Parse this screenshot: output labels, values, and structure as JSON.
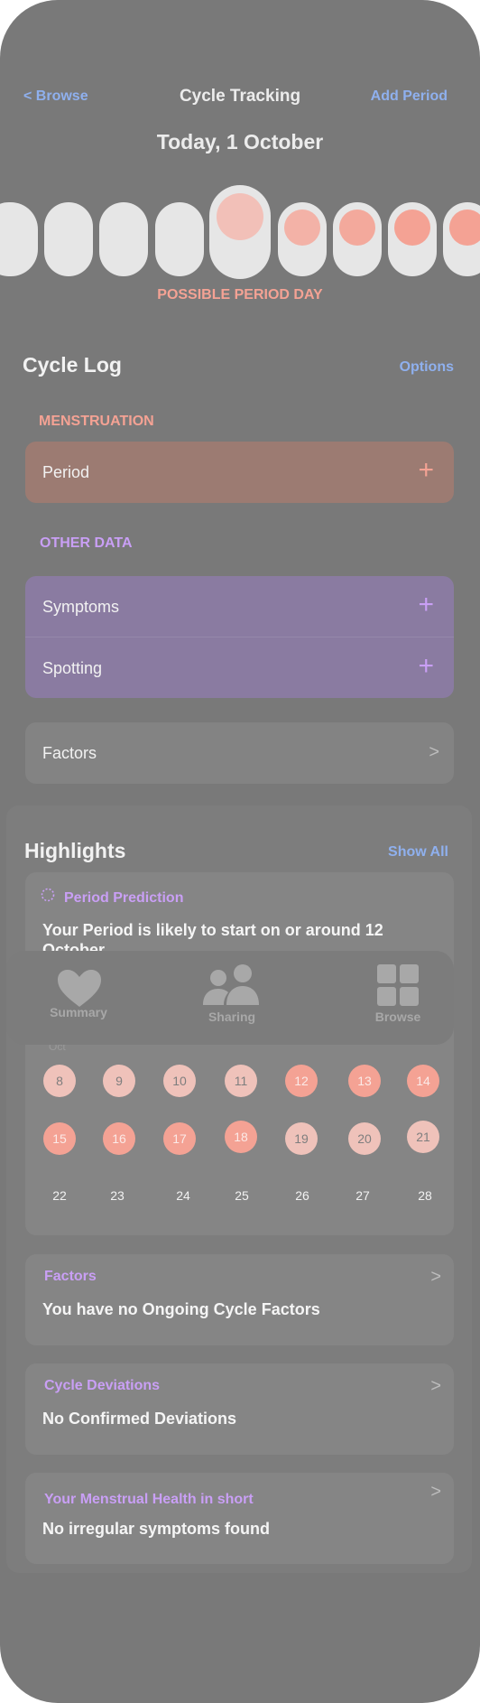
{
  "nav": {
    "back_label": "< Browse",
    "title": "Cycle Tracking",
    "add_label": "Add Period"
  },
  "date_title": "Today, 1 October",
  "day_status": "POSSIBLE PERIOD DAY",
  "cycle_log": {
    "title": "Cycle Log",
    "options_label": "Options",
    "menstruation": {
      "category": "MENSTRUATION",
      "period_label": "Period"
    },
    "other_data": {
      "category": "OTHER DATA",
      "symptoms_label": "Symptoms",
      "spotting_label": "Spotting"
    },
    "factors_label": "Factors"
  },
  "highlights": {
    "title": "Highlights",
    "show_all_label": "Show All",
    "prediction": {
      "title": "Period Prediction",
      "text": "Your Period is likely to start on or around 12 October",
      "month_label": "Oct",
      "rows": [
        [
          "8",
          "9",
          "10",
          "11",
          "12",
          "13",
          "14"
        ],
        [
          "15",
          "16",
          "17",
          "18",
          "19",
          "20",
          "21"
        ],
        [
          "22",
          "23",
          "24",
          "25",
          "26",
          "27",
          "28"
        ]
      ]
    },
    "factors_card": {
      "title": "Factors",
      "text": "You have no Ongoing Cycle Factors"
    },
    "deviations_card": {
      "title": "Cycle Deviations",
      "text": "No Confirmed Deviations"
    },
    "health_card": {
      "title": "Your Menstrual Health in short",
      "text": "No irregular symptoms found"
    }
  },
  "tabbar": {
    "summary_label": "Summary",
    "sharing_label": "Sharing",
    "browse_label": "Browse"
  },
  "icons": {
    "plus": "plus-icon",
    "chevron": "chevron-right-icon",
    "prediction": "dashed-circle-icon",
    "summary": "heart-icon",
    "sharing": "people-icon",
    "browse": "grid-icon"
  },
  "colors": {
    "background": "#797979",
    "accent_blue": "#8fb0ee",
    "period_coral": "#f4a294",
    "purple": "#c99ff5",
    "period_row": "#9c7b72",
    "other_data_row": "#8a7ba1"
  }
}
